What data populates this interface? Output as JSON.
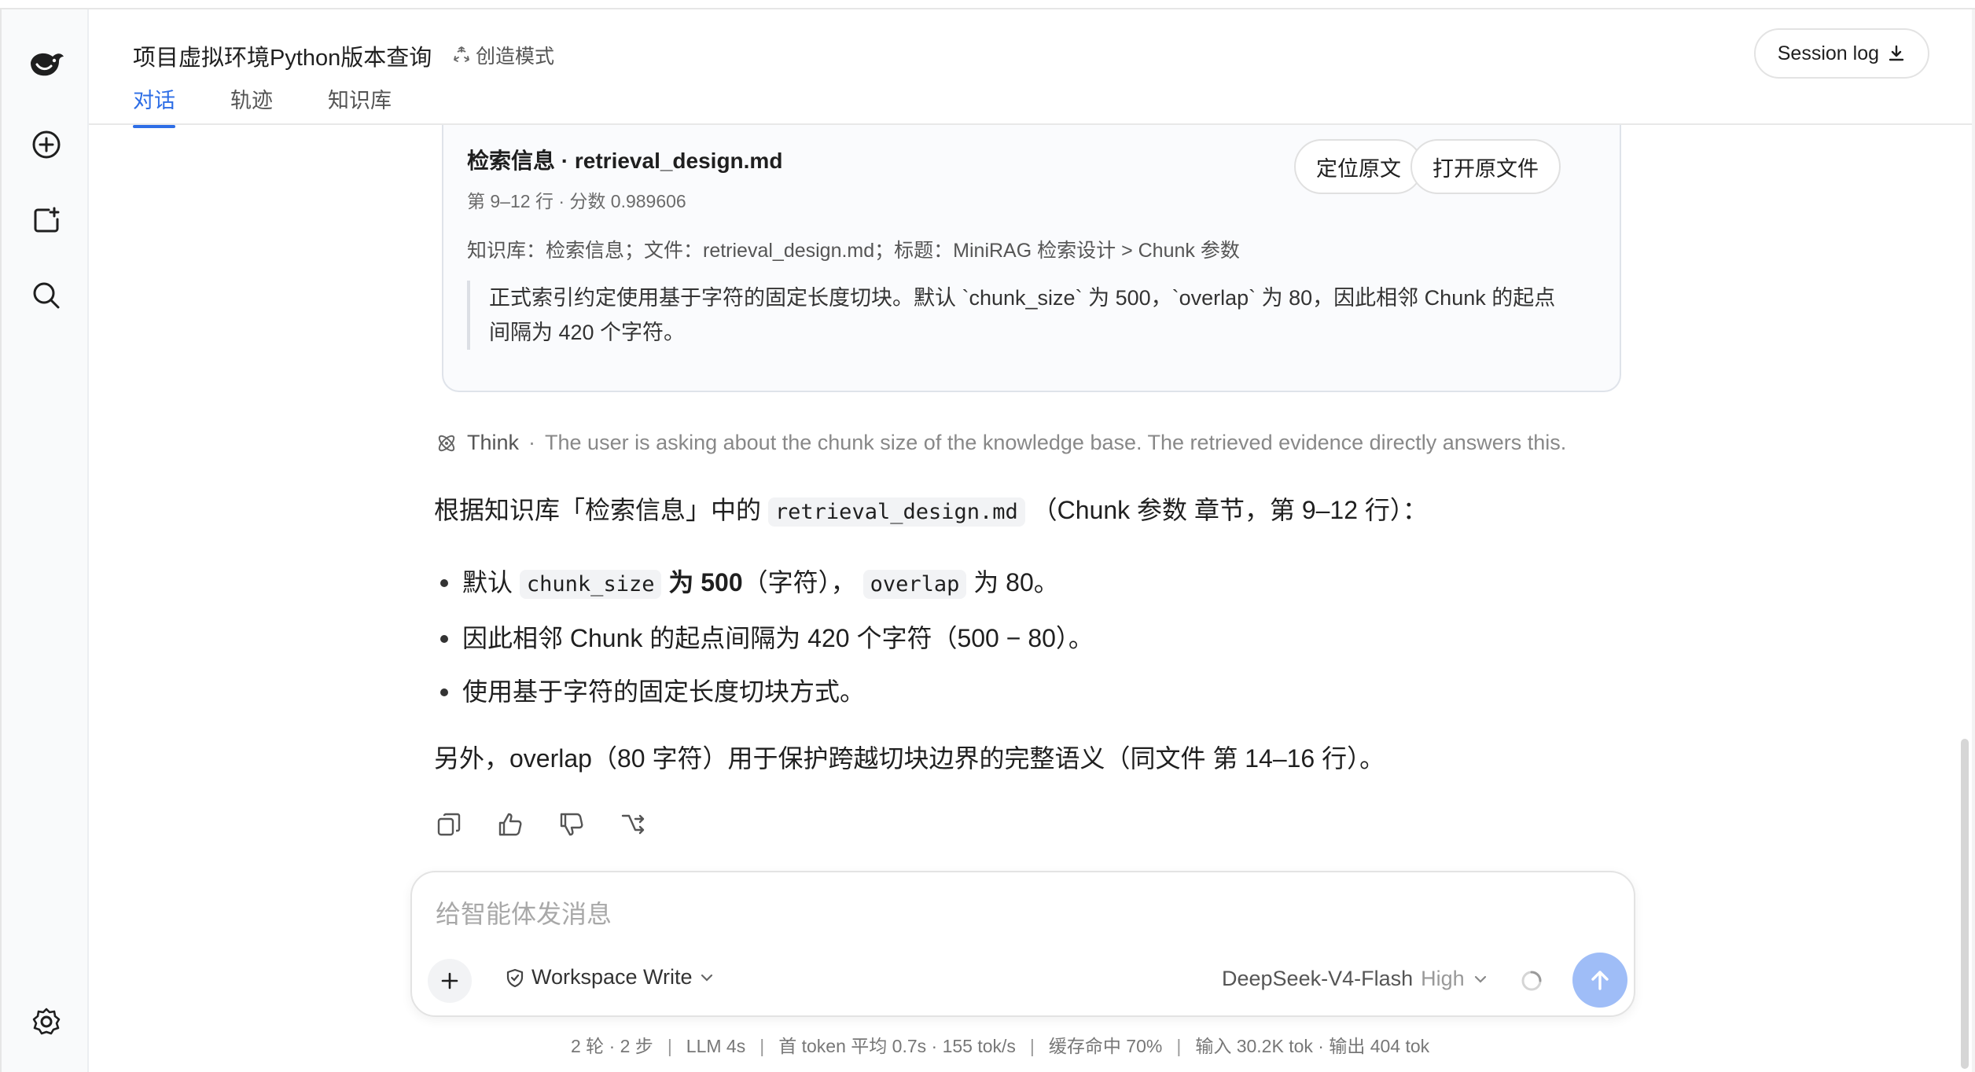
{
  "header": {
    "title": "项目虚拟环境Python版本查询",
    "mode_label": "创造模式",
    "tabs": [
      {
        "label": "对话",
        "active": true
      },
      {
        "label": "轨迹",
        "active": false
      },
      {
        "label": "知识库",
        "active": false
      }
    ],
    "session_log_label": "Session log"
  },
  "rail": {
    "icons": [
      "logo-icon",
      "new-chat-icon",
      "new-project-icon",
      "search-icon",
      "settings-icon"
    ]
  },
  "evidence": {
    "title": "检索信息 · retrieval_design.md",
    "meta": "第 9–12 行 · 分数 0.989606",
    "path": "知识库：检索信息；文件：retrieval_design.md；标题：MiniRAG 检索设计 > Chunk 参数",
    "quote": "正式索引约定使用基于字符的固定长度切块。默认 `chunk_size` 为 500，`overlap` 为 80，因此相邻 Chunk 的起点间隔为 420 个字符。",
    "locate_label": "定位原文",
    "open_label": "打开原文件"
  },
  "think": {
    "label": "Think",
    "separator": "·",
    "text": "The user is asking about the chunk size of the knowledge base. The retrieved evidence directly answers this."
  },
  "answer": {
    "intro_before": "根据知识库「检索信息」中的",
    "intro_code": "retrieval_design.md",
    "intro_after": "（Chunk 参数 章节，第 9–12 行）：",
    "b1_pre": "默认",
    "b1_code1": "chunk_size",
    "b1_bold": "为 500",
    "b1_mid": "（字符），",
    "b1_code2": "overlap",
    "b1_post": "为 80。",
    "b2": "因此相邻 Chunk 的起点间隔为 420 个字符（500 − 80）。",
    "b3": "使用基于字符的固定长度切块方式。",
    "extra": "另外，overlap（80 字符）用于保护跨越切块边界的完整语义（同文件 第 14–16 行）。"
  },
  "actions": [
    "copy-icon",
    "thumbs-up-icon",
    "thumbs-down-icon",
    "branch-icon"
  ],
  "composer": {
    "placeholder": "给智能体发消息",
    "value": "",
    "workspace_label": "Workspace Write",
    "model_name": "DeepSeek-V4-Flash",
    "model_level": "High"
  },
  "stats": {
    "rounds": "2 轮 · 2 步",
    "llm": "LLM 4s",
    "first_token": "首 token 平均 0.7s · 155 tok/s",
    "cache": "缓存命中 70%",
    "io": "输入 30.2K tok · 输出 404 tok"
  },
  "colors": {
    "accent": "#2e6ee6",
    "send_button": "#9fbdf7",
    "card_bg": "#fafbfd"
  }
}
